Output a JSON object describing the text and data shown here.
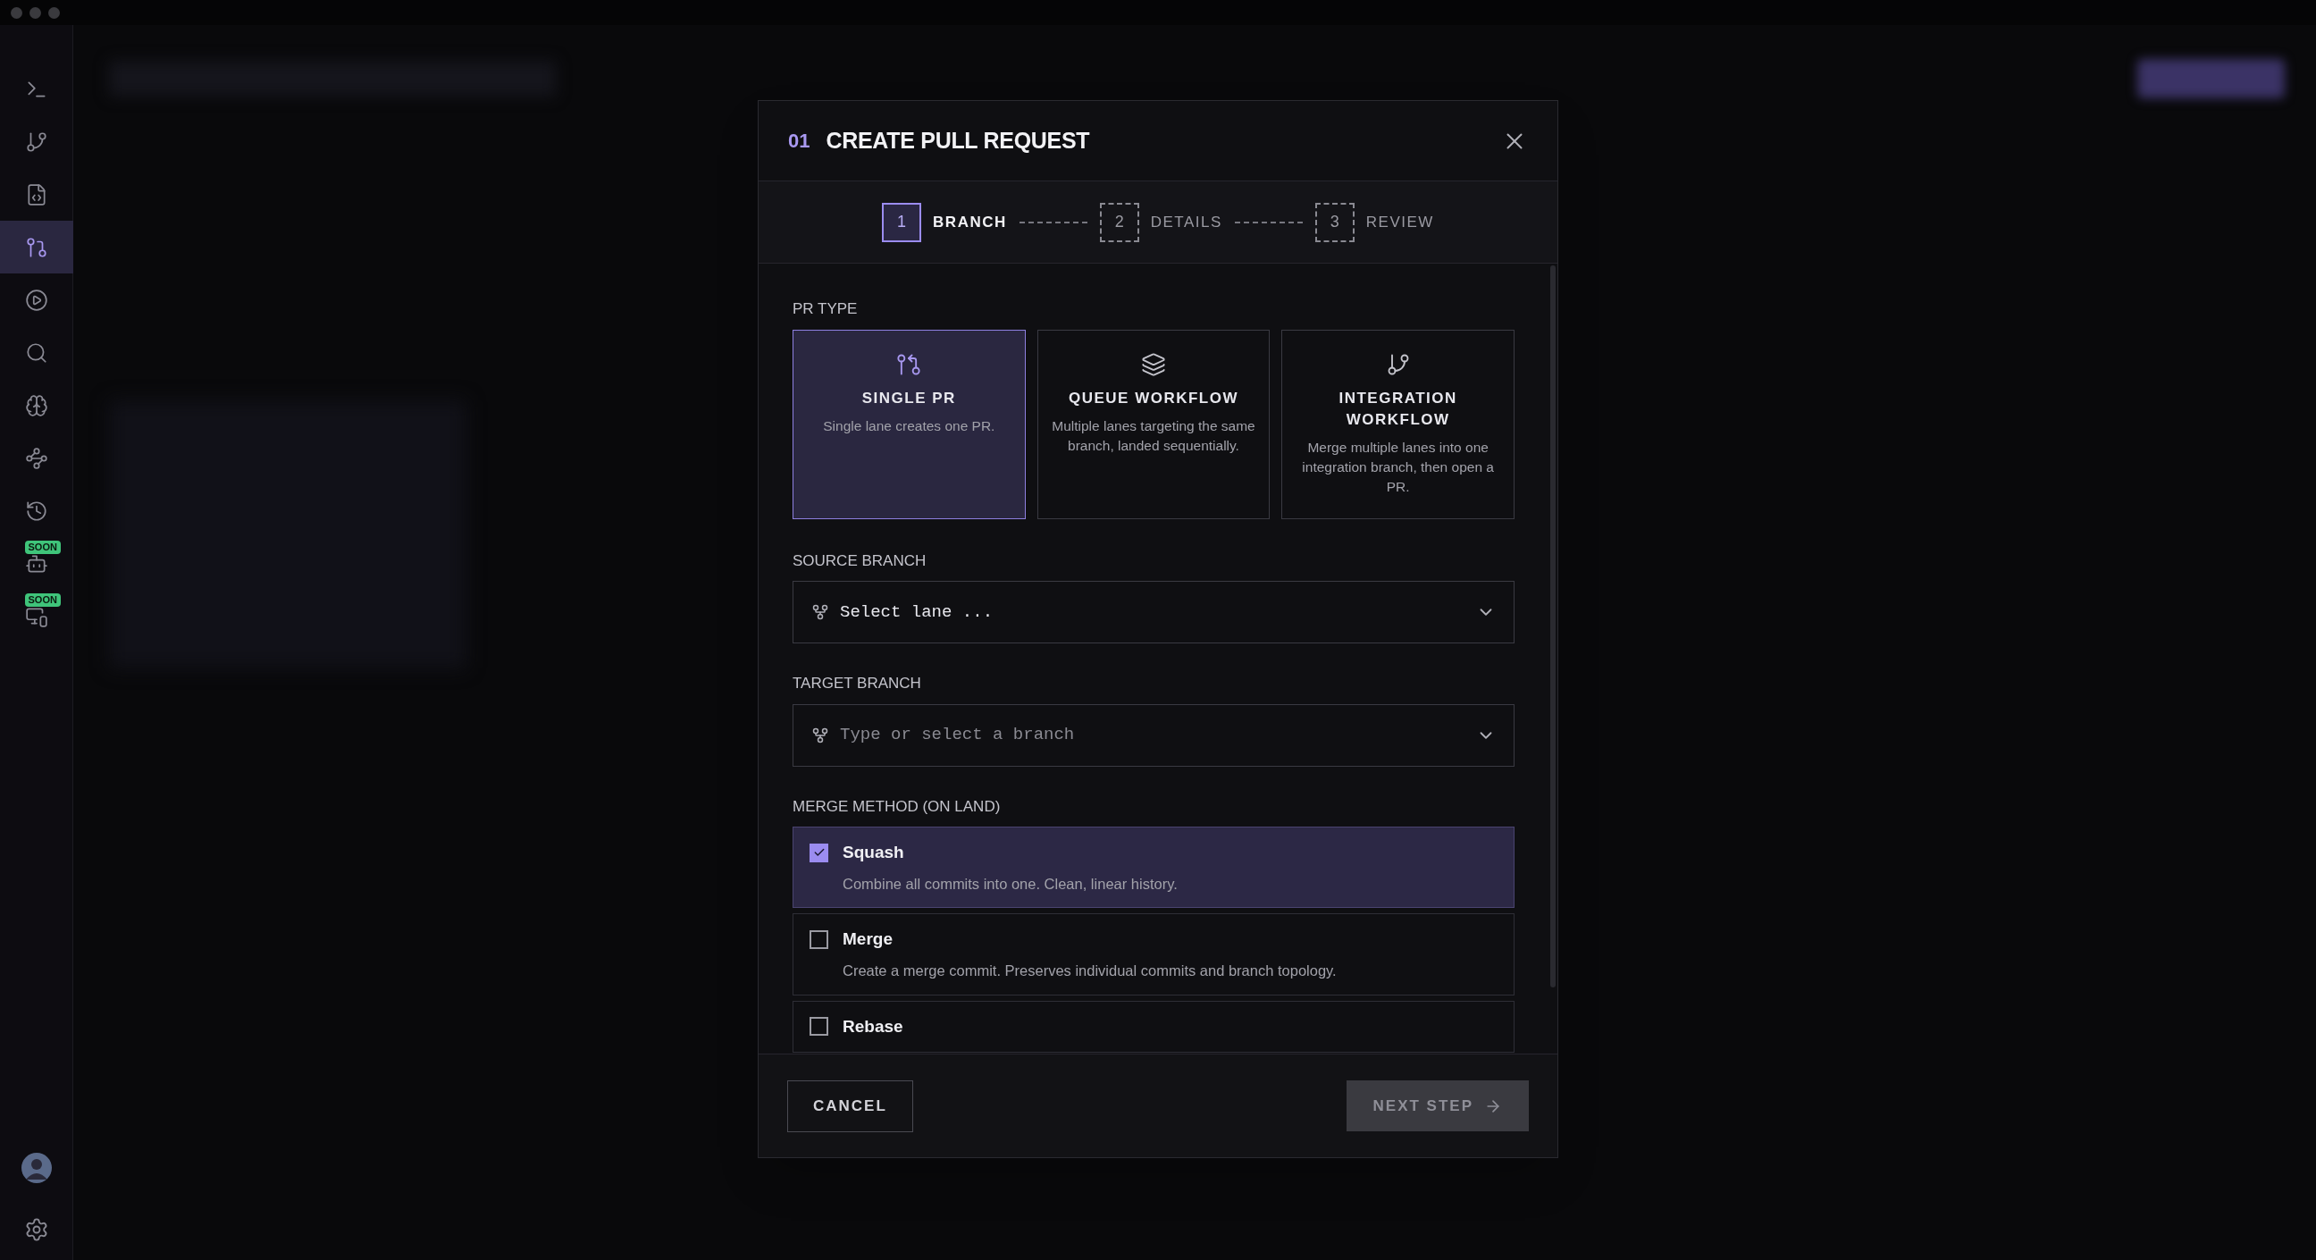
{
  "sidebar": {
    "items": [
      {
        "selected": false
      },
      {
        "selected": false
      },
      {
        "selected": false
      },
      {
        "selected": true
      },
      {
        "selected": false
      },
      {
        "selected": false
      },
      {
        "selected": false
      },
      {
        "selected": false
      },
      {
        "selected": false
      },
      {
        "selected": false,
        "badge": "SOON"
      },
      {
        "selected": false,
        "badge": "SOON"
      }
    ]
  },
  "modal": {
    "step_number": "01",
    "title": "CREATE PULL REQUEST",
    "steps": [
      {
        "number": "1",
        "label": "BRANCH",
        "selected": true
      },
      {
        "number": "2",
        "label": "DETAILS",
        "selected": false
      },
      {
        "number": "3",
        "label": "REVIEW",
        "selected": false
      }
    ],
    "pr_type": {
      "label": "PR TYPE",
      "options": [
        {
          "title": "SINGLE PR",
          "description": "Single lane creates one PR.",
          "selected": true
        },
        {
          "title": "QUEUE WORKFLOW",
          "description": "Multiple lanes targeting the same branch, landed sequentially.",
          "selected": false
        },
        {
          "title": "INTEGRATION WORKFLOW",
          "description": "Merge multiple lanes into one integration branch, then open a PR.",
          "selected": false
        }
      ]
    },
    "source_branch": {
      "label": "SOURCE BRANCH",
      "value": "Select lane ..."
    },
    "target_branch": {
      "label": "TARGET BRANCH",
      "placeholder": "Type or select a branch"
    },
    "merge_method": {
      "label": "MERGE METHOD (ON LAND)",
      "options": [
        {
          "name": "Squash",
          "description": "Combine all commits into one. Clean, linear history.",
          "checked": true
        },
        {
          "name": "Merge",
          "description": "Create a merge commit. Preserves individual commits and branch topology.",
          "checked": false
        },
        {
          "name": "Rebase",
          "checked": false
        }
      ]
    },
    "buttons": {
      "cancel": "CANCEL",
      "next": "NEXT STEP"
    }
  }
}
